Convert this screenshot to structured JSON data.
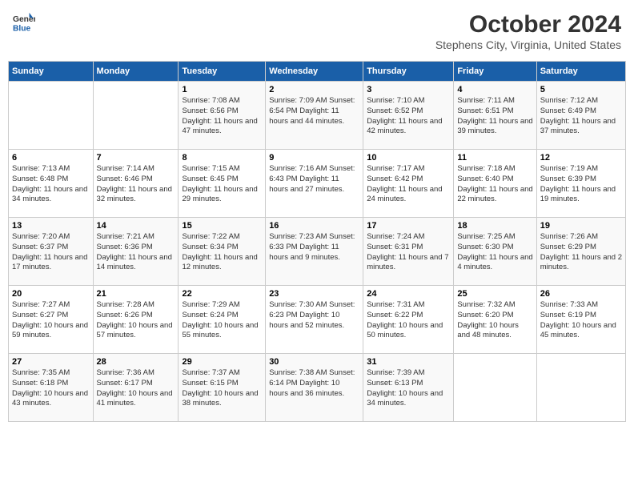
{
  "header": {
    "logo_general": "General",
    "logo_blue": "Blue",
    "title": "October 2024",
    "subtitle": "Stephens City, Virginia, United States"
  },
  "columns": [
    "Sunday",
    "Monday",
    "Tuesday",
    "Wednesday",
    "Thursday",
    "Friday",
    "Saturday"
  ],
  "weeks": [
    [
      {
        "num": "",
        "info": ""
      },
      {
        "num": "",
        "info": ""
      },
      {
        "num": "1",
        "info": "Sunrise: 7:08 AM\nSunset: 6:56 PM\nDaylight: 11 hours and 47 minutes."
      },
      {
        "num": "2",
        "info": "Sunrise: 7:09 AM\nSunset: 6:54 PM\nDaylight: 11 hours and 44 minutes."
      },
      {
        "num": "3",
        "info": "Sunrise: 7:10 AM\nSunset: 6:52 PM\nDaylight: 11 hours and 42 minutes."
      },
      {
        "num": "4",
        "info": "Sunrise: 7:11 AM\nSunset: 6:51 PM\nDaylight: 11 hours and 39 minutes."
      },
      {
        "num": "5",
        "info": "Sunrise: 7:12 AM\nSunset: 6:49 PM\nDaylight: 11 hours and 37 minutes."
      }
    ],
    [
      {
        "num": "6",
        "info": "Sunrise: 7:13 AM\nSunset: 6:48 PM\nDaylight: 11 hours and 34 minutes."
      },
      {
        "num": "7",
        "info": "Sunrise: 7:14 AM\nSunset: 6:46 PM\nDaylight: 11 hours and 32 minutes."
      },
      {
        "num": "8",
        "info": "Sunrise: 7:15 AM\nSunset: 6:45 PM\nDaylight: 11 hours and 29 minutes."
      },
      {
        "num": "9",
        "info": "Sunrise: 7:16 AM\nSunset: 6:43 PM\nDaylight: 11 hours and 27 minutes."
      },
      {
        "num": "10",
        "info": "Sunrise: 7:17 AM\nSunset: 6:42 PM\nDaylight: 11 hours and 24 minutes."
      },
      {
        "num": "11",
        "info": "Sunrise: 7:18 AM\nSunset: 6:40 PM\nDaylight: 11 hours and 22 minutes."
      },
      {
        "num": "12",
        "info": "Sunrise: 7:19 AM\nSunset: 6:39 PM\nDaylight: 11 hours and 19 minutes."
      }
    ],
    [
      {
        "num": "13",
        "info": "Sunrise: 7:20 AM\nSunset: 6:37 PM\nDaylight: 11 hours and 17 minutes."
      },
      {
        "num": "14",
        "info": "Sunrise: 7:21 AM\nSunset: 6:36 PM\nDaylight: 11 hours and 14 minutes."
      },
      {
        "num": "15",
        "info": "Sunrise: 7:22 AM\nSunset: 6:34 PM\nDaylight: 11 hours and 12 minutes."
      },
      {
        "num": "16",
        "info": "Sunrise: 7:23 AM\nSunset: 6:33 PM\nDaylight: 11 hours and 9 minutes."
      },
      {
        "num": "17",
        "info": "Sunrise: 7:24 AM\nSunset: 6:31 PM\nDaylight: 11 hours and 7 minutes."
      },
      {
        "num": "18",
        "info": "Sunrise: 7:25 AM\nSunset: 6:30 PM\nDaylight: 11 hours and 4 minutes."
      },
      {
        "num": "19",
        "info": "Sunrise: 7:26 AM\nSunset: 6:29 PM\nDaylight: 11 hours and 2 minutes."
      }
    ],
    [
      {
        "num": "20",
        "info": "Sunrise: 7:27 AM\nSunset: 6:27 PM\nDaylight: 10 hours and 59 minutes."
      },
      {
        "num": "21",
        "info": "Sunrise: 7:28 AM\nSunset: 6:26 PM\nDaylight: 10 hours and 57 minutes."
      },
      {
        "num": "22",
        "info": "Sunrise: 7:29 AM\nSunset: 6:24 PM\nDaylight: 10 hours and 55 minutes."
      },
      {
        "num": "23",
        "info": "Sunrise: 7:30 AM\nSunset: 6:23 PM\nDaylight: 10 hours and 52 minutes."
      },
      {
        "num": "24",
        "info": "Sunrise: 7:31 AM\nSunset: 6:22 PM\nDaylight: 10 hours and 50 minutes."
      },
      {
        "num": "25",
        "info": "Sunrise: 7:32 AM\nSunset: 6:20 PM\nDaylight: 10 hours and 48 minutes."
      },
      {
        "num": "26",
        "info": "Sunrise: 7:33 AM\nSunset: 6:19 PM\nDaylight: 10 hours and 45 minutes."
      }
    ],
    [
      {
        "num": "27",
        "info": "Sunrise: 7:35 AM\nSunset: 6:18 PM\nDaylight: 10 hours and 43 minutes."
      },
      {
        "num": "28",
        "info": "Sunrise: 7:36 AM\nSunset: 6:17 PM\nDaylight: 10 hours and 41 minutes."
      },
      {
        "num": "29",
        "info": "Sunrise: 7:37 AM\nSunset: 6:15 PM\nDaylight: 10 hours and 38 minutes."
      },
      {
        "num": "30",
        "info": "Sunrise: 7:38 AM\nSunset: 6:14 PM\nDaylight: 10 hours and 36 minutes."
      },
      {
        "num": "31",
        "info": "Sunrise: 7:39 AM\nSunset: 6:13 PM\nDaylight: 10 hours and 34 minutes."
      },
      {
        "num": "",
        "info": ""
      },
      {
        "num": "",
        "info": ""
      }
    ]
  ]
}
